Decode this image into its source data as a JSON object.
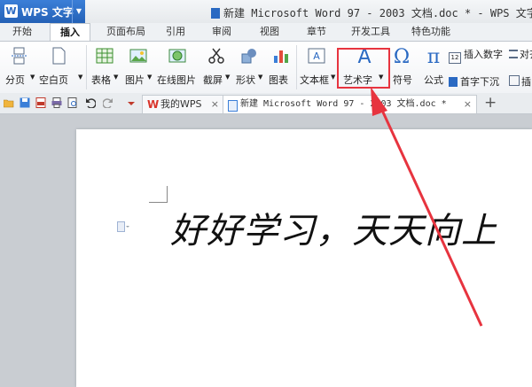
{
  "app": {
    "name": "WPS 文字",
    "logo": "W",
    "dropdown": "▼"
  },
  "window": {
    "title": "新建 Microsoft Word 97 - 2003 文档.doc * - WPS 文字"
  },
  "tabs": [
    {
      "label": "开始"
    },
    {
      "label": "插入"
    },
    {
      "label": "页面布局"
    },
    {
      "label": "引用"
    },
    {
      "label": "审阅"
    },
    {
      "label": "视图"
    },
    {
      "label": "章节"
    },
    {
      "label": "开发工具"
    },
    {
      "label": "特色功能"
    }
  ],
  "ribbon": {
    "page_break": "分页",
    "blank_page": "空白页",
    "table": "表格",
    "picture": "图片",
    "online_picture": "在线图片",
    "screenshot": "截屏",
    "shapes": "形状",
    "chart": "图表",
    "textbox": "文本框",
    "wordart": "艺术字",
    "symbol": "符号",
    "formula": "公式",
    "insert_number": "插入数字",
    "drop_cap": "首字下沉",
    "align": "对齐",
    "insert_other": "插"
  },
  "doc_tabs": {
    "my_wps": "我的WPS",
    "current": "新建 Microsoft Word 97 - 2003 文档.doc *",
    "close": "×",
    "add": "+"
  },
  "document": {
    "text": "好好学习，天天向上"
  },
  "colors": {
    "accent": "#2a69c2",
    "highlight": "#e7343f"
  }
}
